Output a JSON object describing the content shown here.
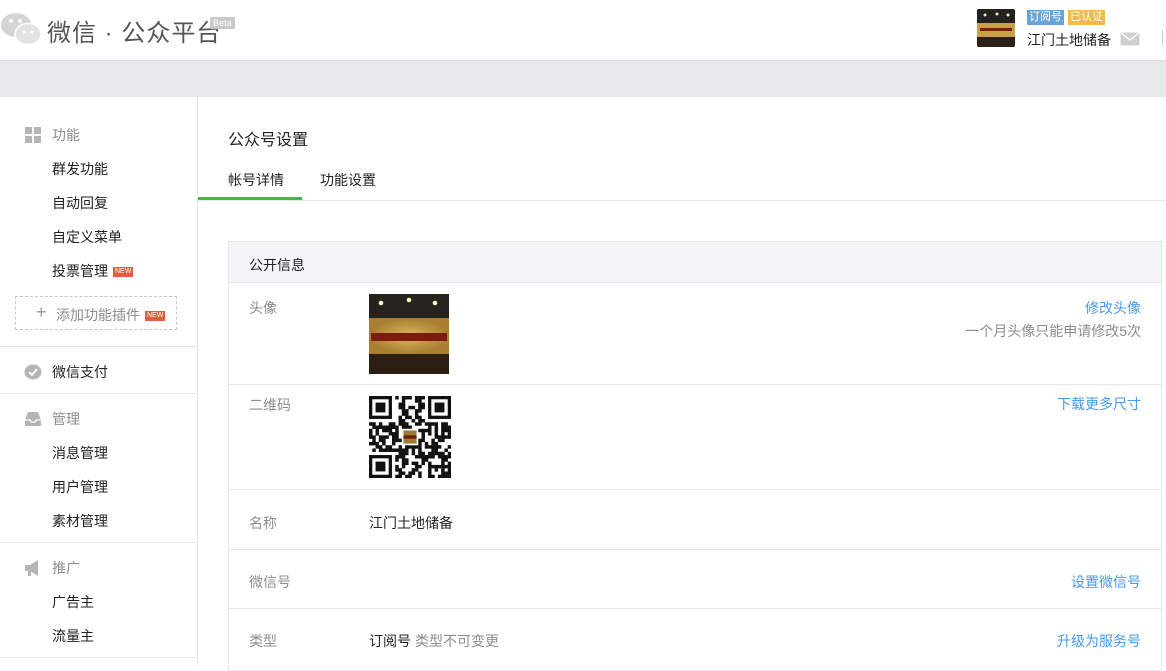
{
  "header": {
    "brand": "微信 · 公众平台",
    "beta": "Beta",
    "account": {
      "type_badge": "订阅号",
      "verify_badge": "已认证",
      "name": "江门土地储备",
      "mail_icon": "mail-icon"
    }
  },
  "sidebar": {
    "groups": [
      {
        "title": "功能",
        "icon": "grid-icon",
        "items": [
          {
            "label": "群发功能"
          },
          {
            "label": "自动回复"
          },
          {
            "label": "自定义菜单"
          },
          {
            "label": "投票管理",
            "badge": "NEW"
          }
        ],
        "addon": {
          "label": "添加功能插件",
          "badge": "NEW"
        }
      },
      {
        "title": "微信支付",
        "icon": "wechat-pay-icon",
        "items": []
      },
      {
        "title": "管理",
        "icon": "inbox-icon",
        "items": [
          {
            "label": "消息管理"
          },
          {
            "label": "用户管理"
          },
          {
            "label": "素材管理"
          }
        ]
      },
      {
        "title": "推广",
        "icon": "megaphone-icon",
        "items": [
          {
            "label": "广告主"
          },
          {
            "label": "流量主"
          }
        ]
      }
    ]
  },
  "main": {
    "title": "公众号设置",
    "tabs": [
      {
        "label": "帐号详情",
        "active": true
      },
      {
        "label": "功能设置",
        "active": false
      }
    ],
    "panel": {
      "title": "公开信息",
      "rows": {
        "avatar": {
          "label": "头像",
          "link": "修改头像",
          "hint": "一个月头像只能申请修改5次"
        },
        "qrcode": {
          "label": "二维码",
          "link": "下载更多尺寸"
        },
        "name": {
          "label": "名称",
          "value": "江门土地储备"
        },
        "wechat_id": {
          "label": "微信号",
          "link": "设置微信号"
        },
        "type": {
          "label": "类型",
          "value": "订阅号",
          "note": "类型不可变更",
          "link": "升级为服务号"
        }
      }
    }
  },
  "colors": {
    "accent_green": "#44b549",
    "link_blue": "#459ae9",
    "badge_blue": "#6aa3d5",
    "badge_orange": "#f2b84b",
    "new_red": "#e15f3f"
  }
}
